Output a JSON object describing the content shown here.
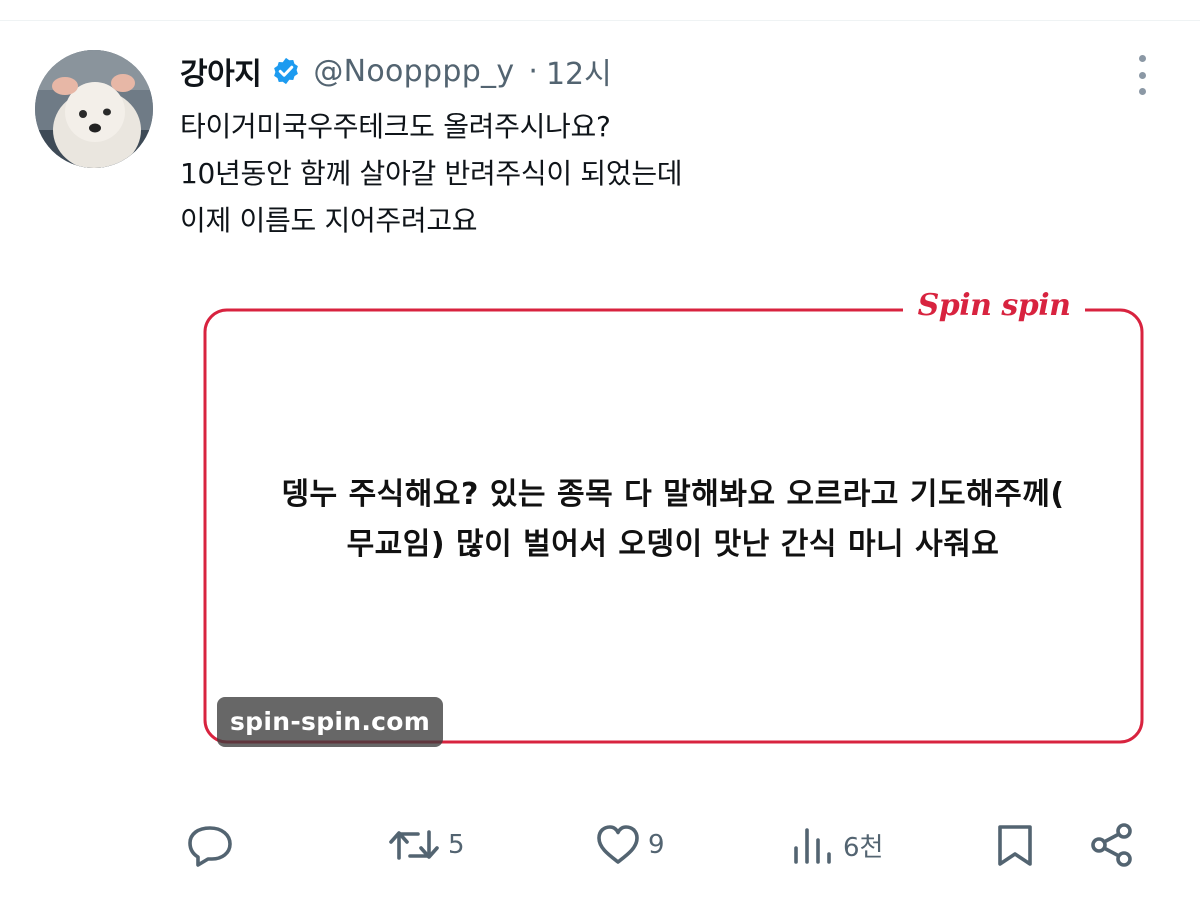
{
  "tweet": {
    "author": {
      "display_name": "강아지",
      "handle": "@Noopppp_y",
      "verified": true,
      "avatar": "white-dog-photo"
    },
    "separator": "·",
    "time": "12시",
    "text_lines": [
      "타이거미국우주테크도 올려주시나요?",
      "10년동안 함께 살아갈 반려주식이 되었는데",
      "이제 이름도 지어주려고요"
    ],
    "media": {
      "logo": "Spin spin",
      "message_lines": [
        "뎅누 주식해요? 있는 종목 다 말해봐요 오르라고 기도해주께(",
        "무교임) 많이 벌어서 오뎅이 맛난 간식 마니 사줘요"
      ],
      "source_badge": "spin-spin.com",
      "frame_color": "#d8233f"
    },
    "actions": {
      "reply": {
        "icon": "reply-icon",
        "count": ""
      },
      "retweet": {
        "icon": "retweet-icon",
        "count": "5"
      },
      "like": {
        "icon": "heart-icon",
        "count": "9"
      },
      "views": {
        "icon": "views-icon",
        "count": "6천"
      },
      "bookmark": {
        "icon": "bookmark-icon"
      },
      "share": {
        "icon": "share-icon"
      }
    }
  },
  "colors": {
    "text": "#0f1419",
    "secondary": "#536471",
    "verified_blue": "#1d9bf0",
    "brand_red": "#d8233f"
  }
}
